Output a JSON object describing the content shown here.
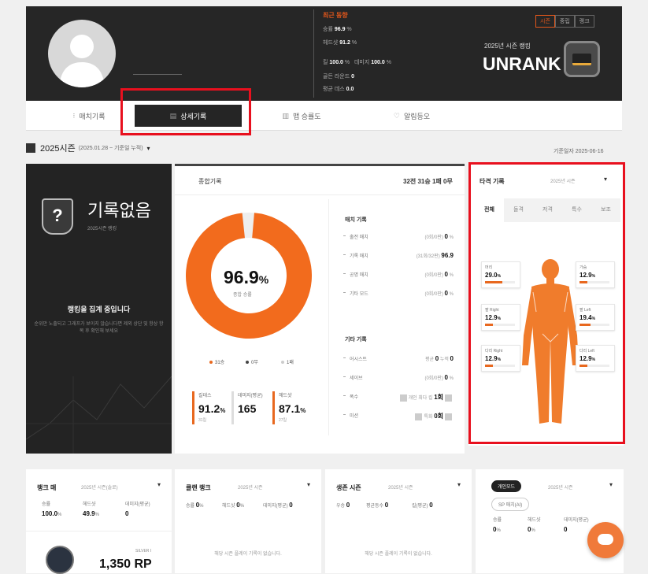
{
  "profile": {
    "recent_title": "최근 동향",
    "recent_stats": [
      {
        "label": "승률",
        "value": "96.9",
        "unit": "%"
      },
      {
        "label": "헤드샷",
        "value": "91.2",
        "unit": "%"
      },
      {
        "label": "킬",
        "value": "100.0",
        "unit": "%",
        "label2": "데미지",
        "value2": "100.0",
        "unit2": "%"
      },
      {
        "label": "골든 라운드",
        "value": "0"
      },
      {
        "label": "평균 데스",
        "value": "0.0"
      }
    ],
    "mode_tabs": [
      "시즌",
      "중립",
      "랭크"
    ],
    "season_label": "2025년 시즌 랭킹",
    "rank": "UNRANK"
  },
  "nav": {
    "tabs": [
      {
        "icon": "⁝",
        "label": "매치기록"
      },
      {
        "icon": "▤",
        "label": "상세기록"
      },
      {
        "icon": "▥",
        "label": "맵 승률도"
      },
      {
        "icon": "♡",
        "label": "알림등오"
      }
    ]
  },
  "season": {
    "title": "2025시즌",
    "range": "(2025.01.28 ~ 기준일 누적)",
    "base_date": "기준일자 2025-06-16"
  },
  "left_card": {
    "no_record": "기록없음",
    "sub": "2025시즌 랭킹",
    "msg1": "랭킹을 집계 중입니다",
    "msg2": "순위만 노출되고 그래프가 보이지 않습니다면 제외 상단 및 항상 항목 후 확인해 보세요"
  },
  "middle": {
    "title": "종합기록",
    "score": "32전 31승 1패 0무",
    "donut_pct": 96.9,
    "donut_label": "96.9",
    "donut_unit": "%",
    "donut_sub": "종합 승률",
    "legend": [
      {
        "label": "31승",
        "color": "#e8681f"
      },
      {
        "label": "0무",
        "color": "#444444"
      },
      {
        "label": "1패",
        "color": "#cccccc"
      }
    ],
    "metrics": [
      {
        "title": "킬데스",
        "value": "91.2",
        "unit": "%",
        "sub": "31킬"
      },
      {
        "title": "데미지(평균)",
        "value": "165",
        "unit": "",
        "sub": ""
      },
      {
        "title": "헤드샷",
        "value": "87.1",
        "unit": "%",
        "sub": "27킬"
      }
    ],
    "section1": "매치 기록",
    "match_rows": [
      {
        "label": "출전 매치",
        "note": "(0회/0판)",
        "value": "0",
        "unit": "%"
      },
      {
        "label": "기록 매치",
        "note": "(31회/32판)",
        "value": "96.9",
        "unit": ""
      },
      {
        "label": "공명 매치",
        "note": "(0회/0판)",
        "value": "0",
        "unit": "%"
      },
      {
        "label": "기타 모드",
        "note": "(0회/0판)",
        "value": "0",
        "unit": "%"
      }
    ],
    "section2": "기타 기록",
    "other_rows": [
      {
        "label": "어시스트",
        "note": "평균",
        "value": "0",
        "note2": "누적",
        "value2": "0"
      },
      {
        "label": "세이브",
        "note": "(0회/0판)",
        "value": "0",
        "unit": "%"
      },
      {
        "label": "폭수",
        "note": "개인 최다 킬",
        "value": "1회"
      },
      {
        "label": "미션",
        "note": "특화",
        "value": "0회"
      }
    ]
  },
  "hit": {
    "title": "타격 기록",
    "select": "2025년 시즌",
    "tabs": [
      "전체",
      "돌격",
      "저격",
      "특수",
      "보조"
    ],
    "parts": [
      {
        "name": "머리",
        "value": "29.0",
        "pct": 0.29
      },
      {
        "name": "가슴",
        "value": "12.9",
        "pct": 0.13
      },
      {
        "name": "팔 Right",
        "value": "12.9",
        "pct": 0.13
      },
      {
        "name": "팔 Left",
        "value": "19.4",
        "pct": 0.19
      },
      {
        "name": "다리 Right",
        "value": "12.9",
        "pct": 0.13
      },
      {
        "name": "다리 Left",
        "value": "12.9",
        "pct": 0.13
      }
    ],
    "unit": "%"
  },
  "bottom": {
    "cards": [
      {
        "title": "랭크 매",
        "select": "2025년 시즌(솔로)",
        "stats": [
          {
            "l": "승률",
            "v": "100.0",
            "u": "%"
          },
          {
            "l": "헤드샷",
            "v": "49.9",
            "u": "%"
          },
          {
            "l": "데미지(평균)",
            "v": "0",
            "u": ""
          }
        ]
      },
      {
        "title": "클랜 랭크",
        "select": "2025년 시즌",
        "stats": [
          {
            "l": "승률",
            "v": "0",
            "u": "%"
          },
          {
            "l": "헤드샷",
            "v": "0",
            "u": "%"
          },
          {
            "l": "데미지(평균)",
            "v": "0",
            "u": ""
          }
        ],
        "empty": "해당 시즌 플레이 기록이 없습니다."
      },
      {
        "title": "생존 시즌",
        "select": "2025년 시즌",
        "stats": [
          {
            "l": "우승",
            "v": "0",
            "u": ""
          },
          {
            "l": "평균등수",
            "v": "0",
            "u": ""
          },
          {
            "l": "킬(평균)",
            "v": "0",
            "u": ""
          }
        ],
        "empty": "해당 시즌 플레이 기록이 없습니다."
      },
      {
        "title": "",
        "pill": "개인모드",
        "pill2": "SP 매치(AI)",
        "select": "2025년 시즌",
        "stats": [
          {
            "l": "승률",
            "v": "0",
            "u": "%"
          },
          {
            "l": "헤드샷",
            "v": "0",
            "u": "%"
          },
          {
            "l": "데미지(평균)",
            "v": "0",
            "u": ""
          }
        ]
      }
    ],
    "rp": "1,350 RP",
    "rp_tier": "SILVER I"
  }
}
